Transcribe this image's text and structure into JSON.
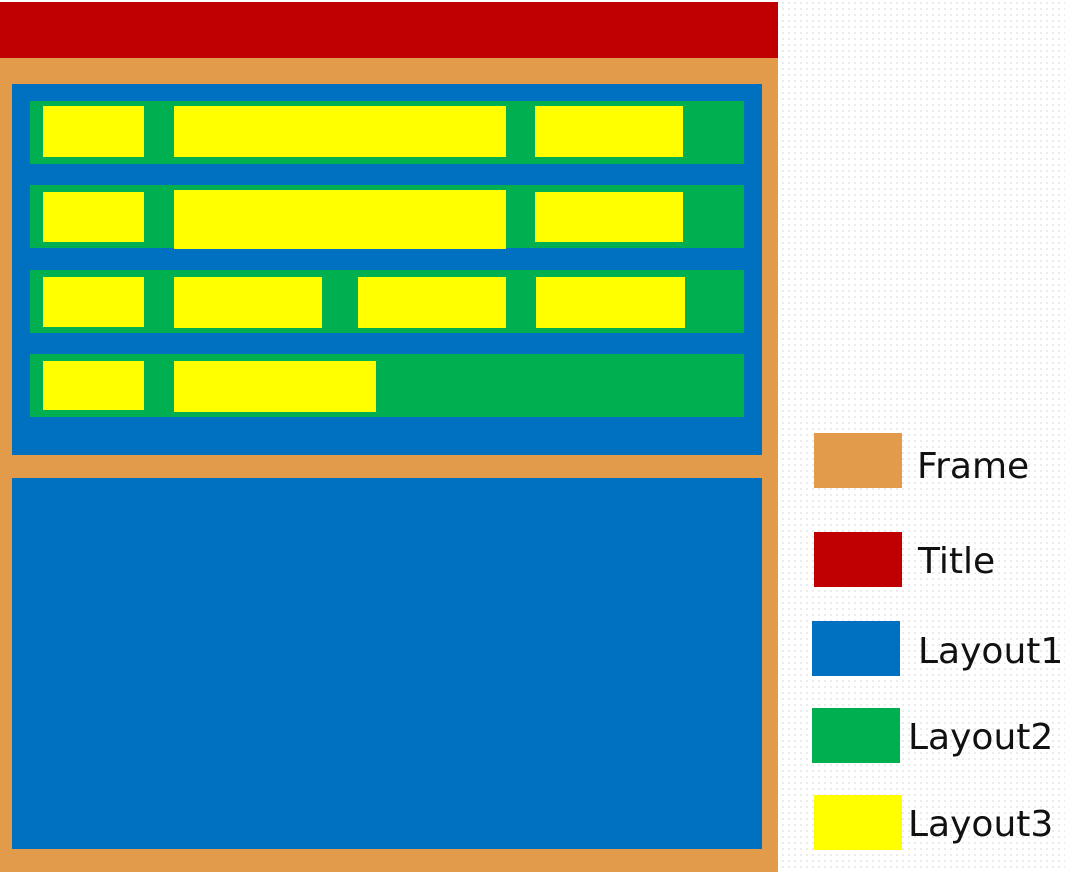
{
  "colors": {
    "frame": "#E19B4A",
    "title": "#C00000",
    "layout1": "#0070C0",
    "layout2": "#00B050",
    "layout3": "#FFFF00"
  },
  "diagram": {
    "rows": [
      {
        "cells": 3
      },
      {
        "cells": 3
      },
      {
        "cells": 4
      },
      {
        "cells": 2
      }
    ]
  },
  "legend": {
    "items": [
      {
        "label": "Frame",
        "color": "#E19B4A"
      },
      {
        "label": "Title",
        "color": "#C00000"
      },
      {
        "label": "Layout1",
        "color": "#0070C0"
      },
      {
        "label": "Layout2",
        "color": "#00B050"
      },
      {
        "label": "Layout3",
        "color": "#FFFF00"
      }
    ]
  }
}
